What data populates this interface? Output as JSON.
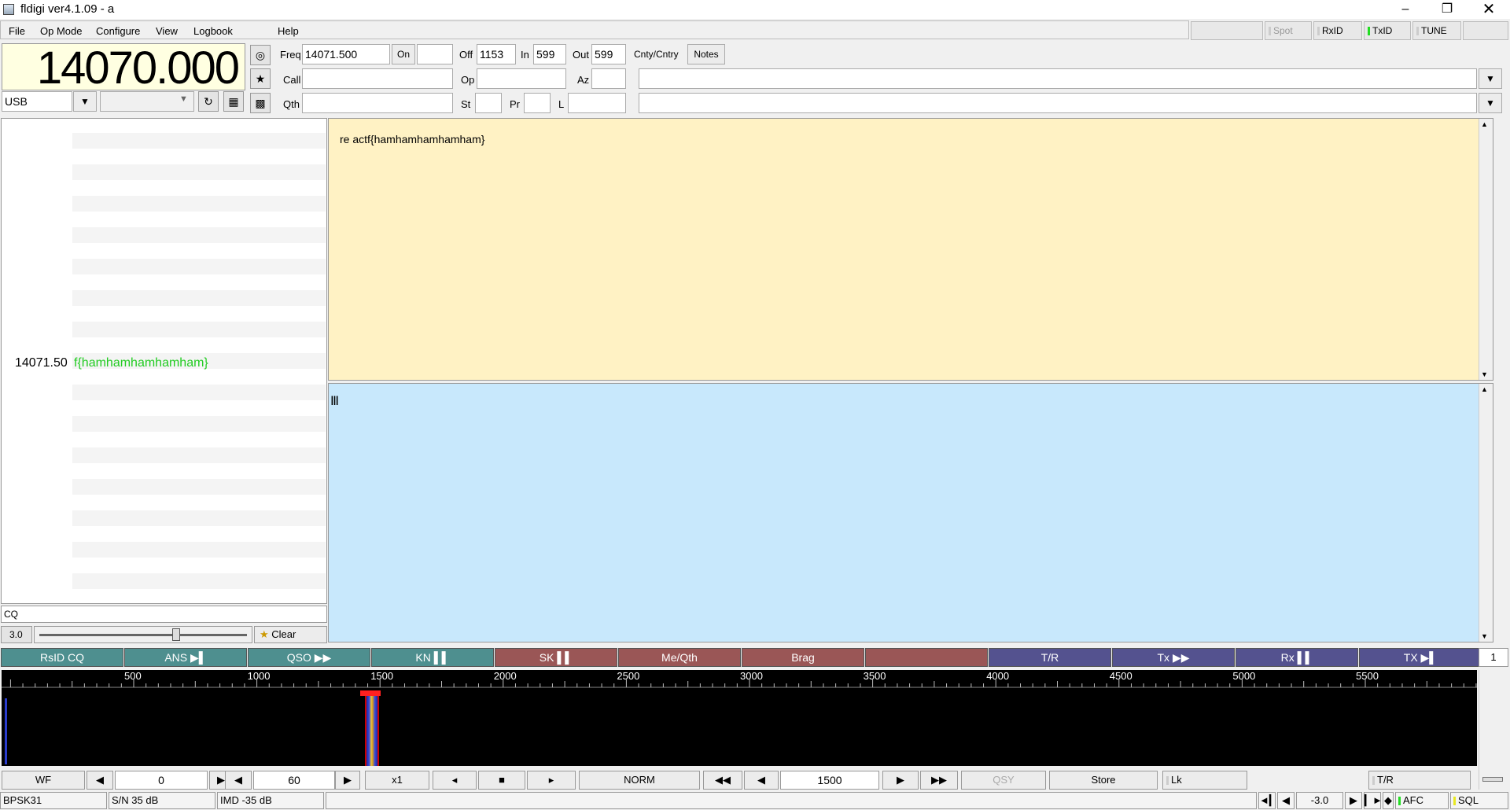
{
  "window": {
    "title": "fldigi ver4.1.09 - a"
  },
  "menu": {
    "file": "File",
    "opmode": "Op Mode",
    "configure": "Configure",
    "view": "View",
    "logbook": "Logbook",
    "help": "Help"
  },
  "toolbar_right": {
    "spot": "Spot",
    "rxid": "RxID",
    "txid": "TxID",
    "tune": "TUNE"
  },
  "freq_display": "14070.000",
  "mode_select": "USB",
  "log": {
    "freq_label": "Freq",
    "freq_value": "14071.500",
    "on_label": "On",
    "off_label": "Off",
    "off_value": "1153",
    "in_label": "In",
    "in_value": "599",
    "out_label": "Out",
    "out_value": "599",
    "cnty_label": "Cnty/Cntry",
    "notes_label": "Notes",
    "call_label": "Call",
    "op_label": "Op",
    "az_label": "Az",
    "qth_label": "Qth",
    "st_label": "St",
    "pr_label": "Pr",
    "l_label": "L"
  },
  "browser": {
    "entry_freq": "14071.50",
    "entry_text": "f{hamhamhamhamham}",
    "cq_text": "CQ",
    "squelch_value": "3.0",
    "clear_label": "Clear"
  },
  "rx_text": "re  actf{hamhamhamhamham}",
  "macros": [
    {
      "label": "RsID CQ",
      "color": "teal"
    },
    {
      "label": "ANS ▶▌",
      "color": "teal"
    },
    {
      "label": "QSO ▶▶",
      "color": "teal"
    },
    {
      "label": "KN ▌▌",
      "color": "teal"
    },
    {
      "label": "SK ▌▌",
      "color": "red"
    },
    {
      "label": "Me/Qth",
      "color": "red"
    },
    {
      "label": "Brag",
      "color": "red"
    },
    {
      "label": "",
      "color": "red"
    },
    {
      "label": "T/R",
      "color": "blue"
    },
    {
      "label": "Tx ▶▶",
      "color": "blue"
    },
    {
      "label": "Rx ▌▌",
      "color": "blue"
    },
    {
      "label": "TX ▶▌",
      "color": "blue"
    }
  ],
  "macro_page": "1",
  "scale_ticks": [
    "500",
    "1000",
    "1500",
    "2000",
    "2500",
    "3000",
    "3500",
    "4000",
    "4500",
    "5000",
    "5500"
  ],
  "bottom": {
    "wf_label": "WF",
    "ref_value": "0",
    "range_value": "60",
    "x1_label": "x1",
    "norm_label": "NORM",
    "carrier_value": "1500",
    "qsy_label": "QSY",
    "store_label": "Store",
    "lk_label": "Lk",
    "tr_label": "T/R"
  },
  "status": {
    "mode": "BPSK31",
    "snr": "S/N 35 dB",
    "imd": "IMD -35 dB",
    "offset": "-3.0",
    "afc": "AFC",
    "sql": "SQL"
  },
  "colors": {
    "rx_bg": "#fff2c4",
    "tx_bg": "#c8e8fc",
    "browser_text": "#22cc22",
    "macro_teal": "#4e8f8f",
    "macro_red": "#9a5656",
    "macro_blue": "#54528f",
    "led_green": "#22dd22"
  }
}
